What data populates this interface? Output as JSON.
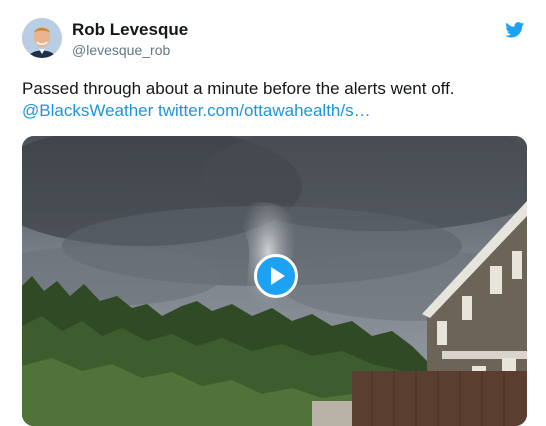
{
  "author": {
    "display_name": "Rob Levesque",
    "handle": "@levesque_rob"
  },
  "tweet": {
    "text": "Passed through about a minute before the alerts went off.",
    "mention": "@BlacksWeather",
    "link": "twitter.com/ottawahealth/s…"
  },
  "icons": {
    "brand": "twitter-bird-icon",
    "play": "play-icon"
  },
  "colors": {
    "link": "#1b95e0",
    "brand": "#1da1f2",
    "handle": "#657786"
  }
}
